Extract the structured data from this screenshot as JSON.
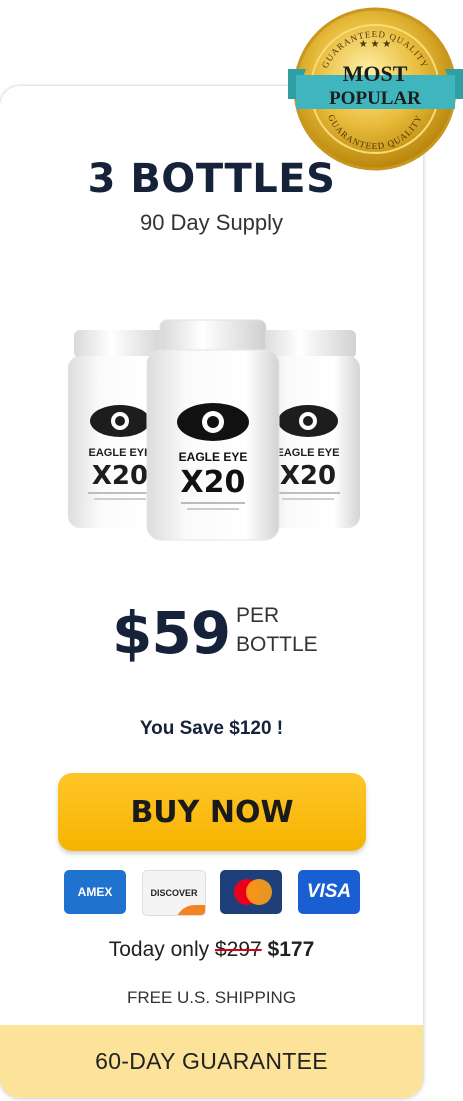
{
  "offer": {
    "title": "3 BOTTLES",
    "subtitle": "90 Day Supply",
    "product": {
      "brand_line1": "EAGLE EYE",
      "brand_line2": "X20"
    },
    "price": "$59",
    "per_line1": "PER",
    "per_line2": "BOTTLE",
    "savings": "You Save $120 !",
    "buy_label": "BUY NOW",
    "payment_cards": [
      {
        "name": "AMEX",
        "icon": "amex-icon"
      },
      {
        "name": "DISCOVER",
        "icon": "discover-icon"
      },
      {
        "name": "MasterCard",
        "icon": "mastercard-icon"
      },
      {
        "name": "VISA",
        "icon": "visa-icon"
      }
    ],
    "today_prefix": "Today only",
    "old_price": "$297",
    "new_price": "$177",
    "shipping": "FREE U.S. SHIPPING",
    "guarantee": "60-DAY GUARANTEE"
  },
  "badge": {
    "ring_top": "GUARANTEED QUALITY",
    "ring_bottom": "GUARANTEED QUALITY",
    "line1": "MOST",
    "line2": "POPULAR"
  },
  "colors": {
    "button": "#f8bb0f",
    "guarantee_band": "#fde29a",
    "title": "#16213a",
    "badge_gold": "#d9a925",
    "ribbon": "#3fb6bd"
  }
}
